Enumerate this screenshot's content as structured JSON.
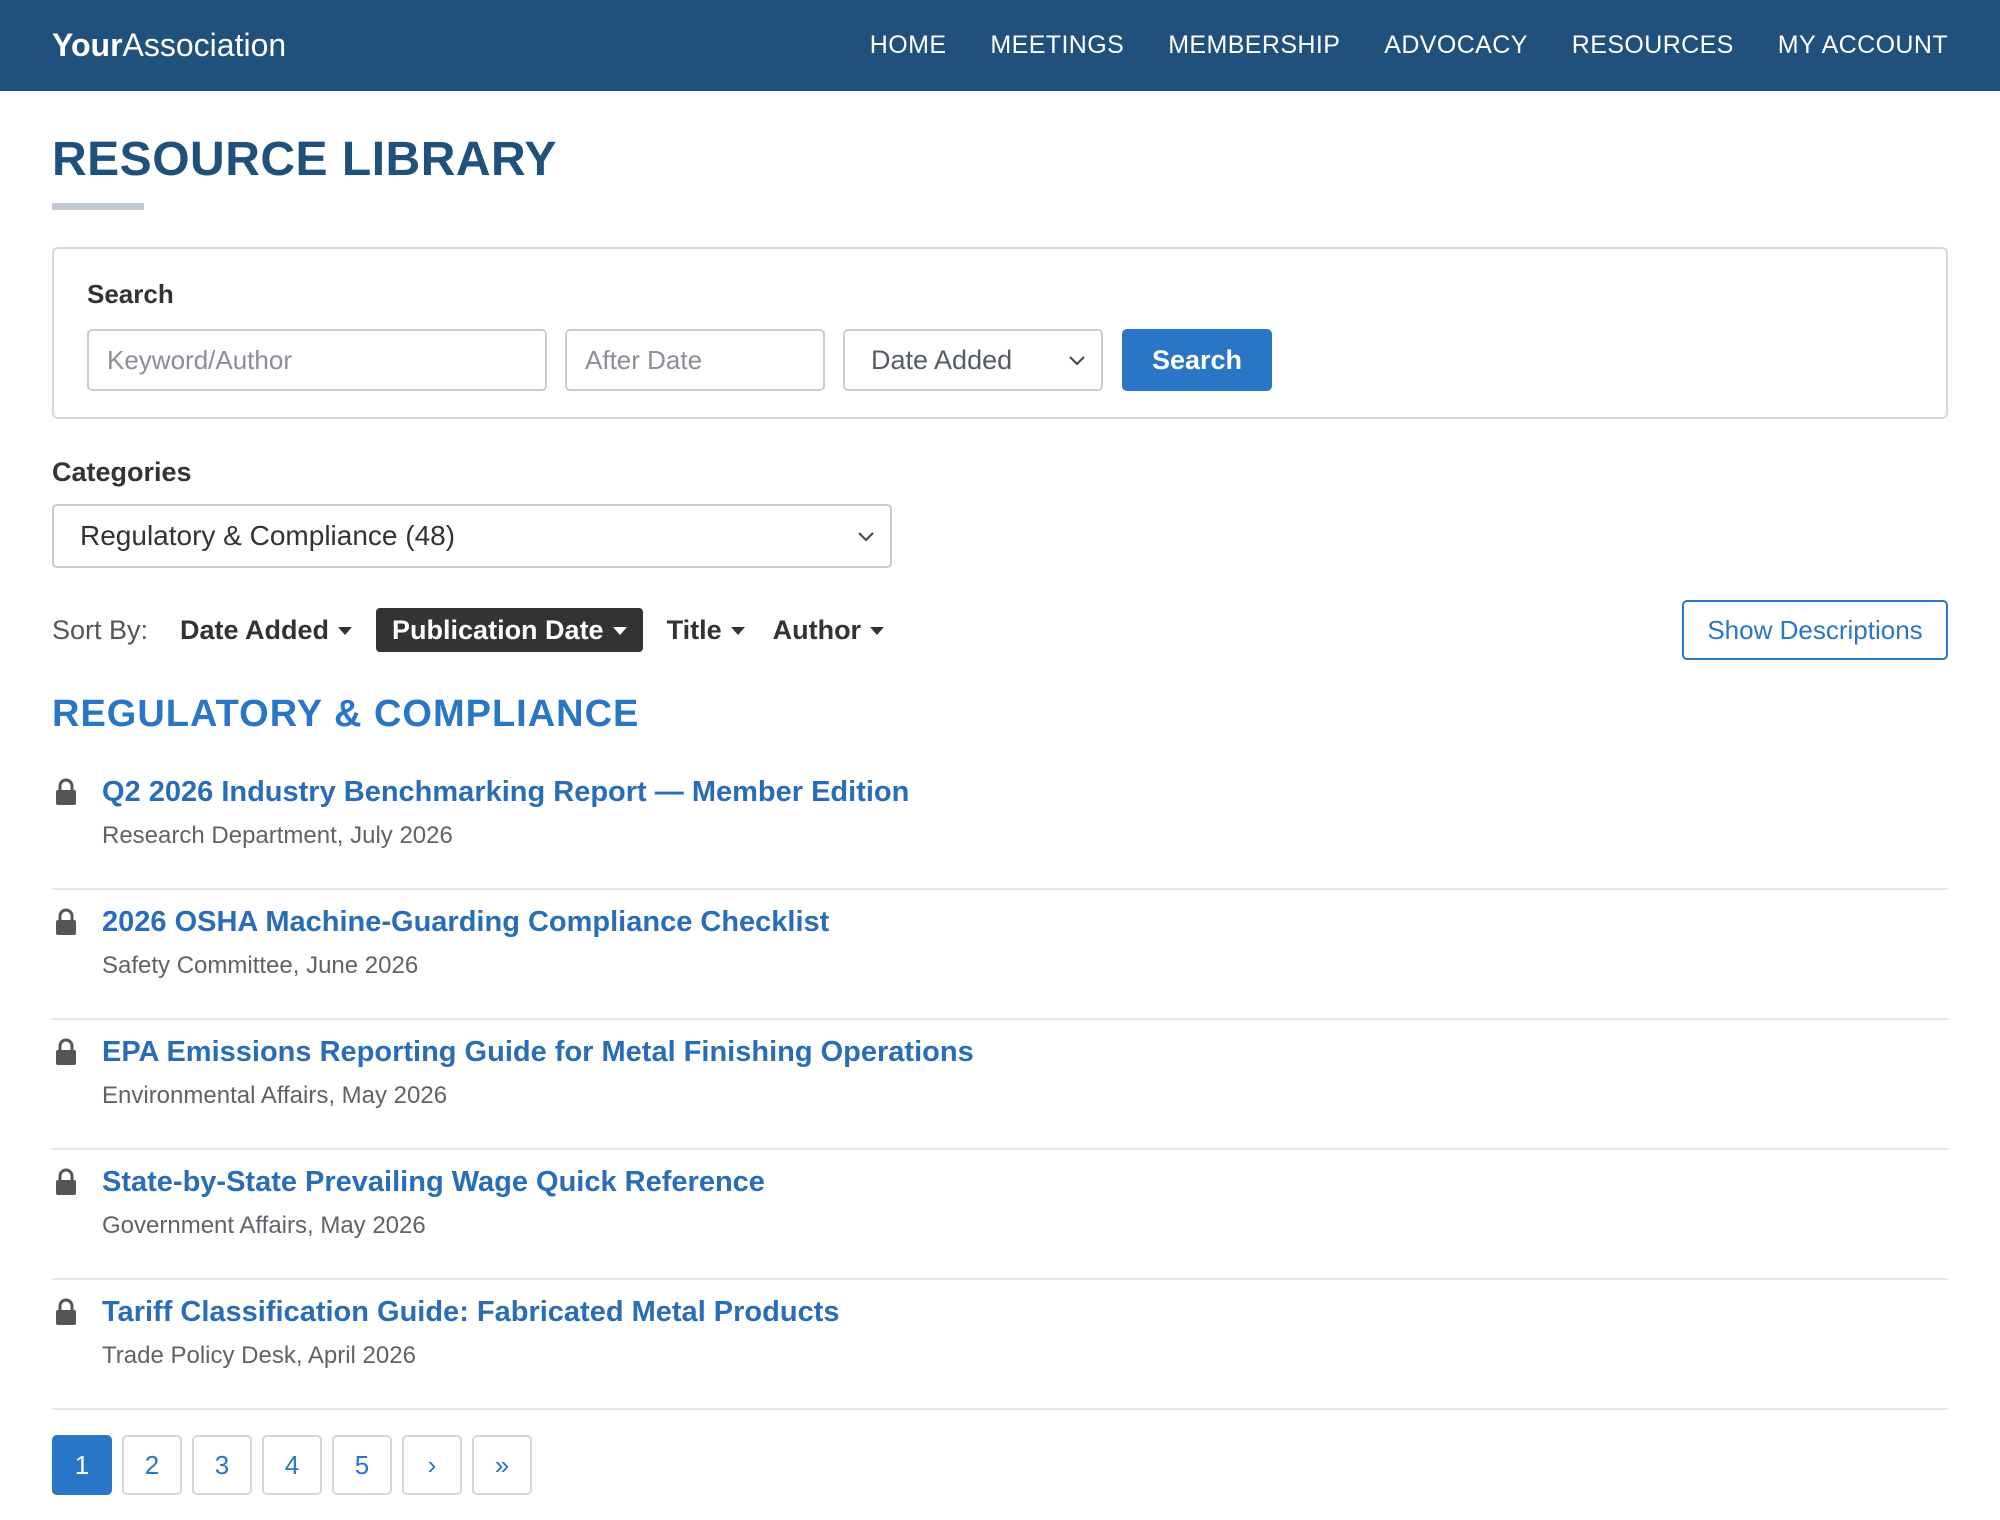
{
  "brand": {
    "strong": "Your",
    "light": "Association"
  },
  "nav": {
    "items": [
      {
        "label": "HOME"
      },
      {
        "label": "MEETINGS"
      },
      {
        "label": "MEMBERSHIP"
      },
      {
        "label": "ADVOCACY"
      },
      {
        "label": "RESOURCES"
      },
      {
        "label": "MY ACCOUNT"
      }
    ]
  },
  "page": {
    "title": "RESOURCE LIBRARY"
  },
  "search": {
    "label": "Search",
    "keyword_placeholder": "Keyword/Author",
    "keyword_value": "",
    "date_placeholder": "After Date",
    "date_value": "",
    "sort_selected": "Date Added",
    "button_label": "Search"
  },
  "categories": {
    "label": "Categories",
    "selected": "Regulatory & Compliance (48)"
  },
  "sort": {
    "label": "Sort By:",
    "options": [
      {
        "label": "Date Added",
        "active": false
      },
      {
        "label": "Publication Date",
        "active": true
      },
      {
        "label": "Title",
        "active": false
      },
      {
        "label": "Author",
        "active": false
      }
    ],
    "show_descriptions_label": "Show Descriptions"
  },
  "section": {
    "heading": "REGULATORY & COMPLIANCE"
  },
  "resources": [
    {
      "title": "Q2 2026 Industry Benchmarking Report — Member Edition",
      "meta": "Research Department, July 2026",
      "icon": "lock-icon"
    },
    {
      "title": "2026 OSHA Machine-Guarding Compliance Checklist",
      "meta": "Safety Committee, June 2026",
      "icon": "lock-icon"
    },
    {
      "title": "EPA Emissions Reporting Guide for Metal Finishing Operations",
      "meta": "Environmental Affairs, May 2026",
      "icon": "lock-icon"
    },
    {
      "title": "State-by-State Prevailing Wage Quick Reference",
      "meta": "Government Affairs, May 2026",
      "icon": "lock-icon"
    },
    {
      "title": "Tariff Classification Guide: Fabricated Metal Products",
      "meta": "Trade Policy Desk, April 2026",
      "icon": "lock-icon"
    }
  ],
  "pagination": {
    "current": 1,
    "pages": [
      "1",
      "2",
      "3",
      "4",
      "5"
    ],
    "next": "›",
    "last": "»"
  },
  "colors": {
    "nav_bg": "#20507c",
    "title": "#20507c",
    "accent": "#2a76c6",
    "link": "#2a6db7"
  }
}
